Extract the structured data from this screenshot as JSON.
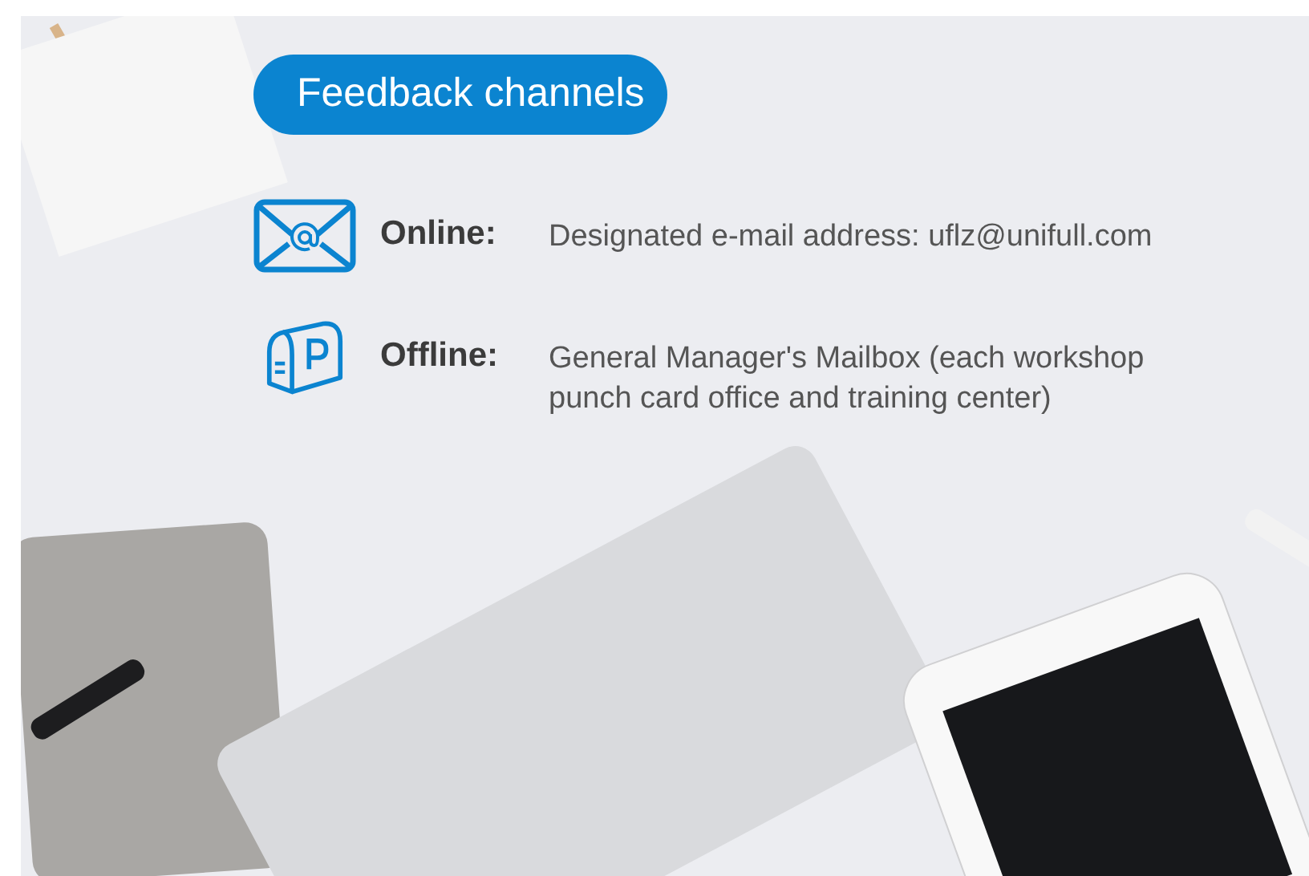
{
  "heading": "Feedback channels",
  "channels": [
    {
      "kind": "email",
      "label": "Online:",
      "text": "Designated e-mail address: uflz@unifull.com"
    },
    {
      "kind": "mailbox",
      "label": "Offline:",
      "text": "General Manager's Mailbox (each workshop punch card office and training center)"
    }
  ]
}
